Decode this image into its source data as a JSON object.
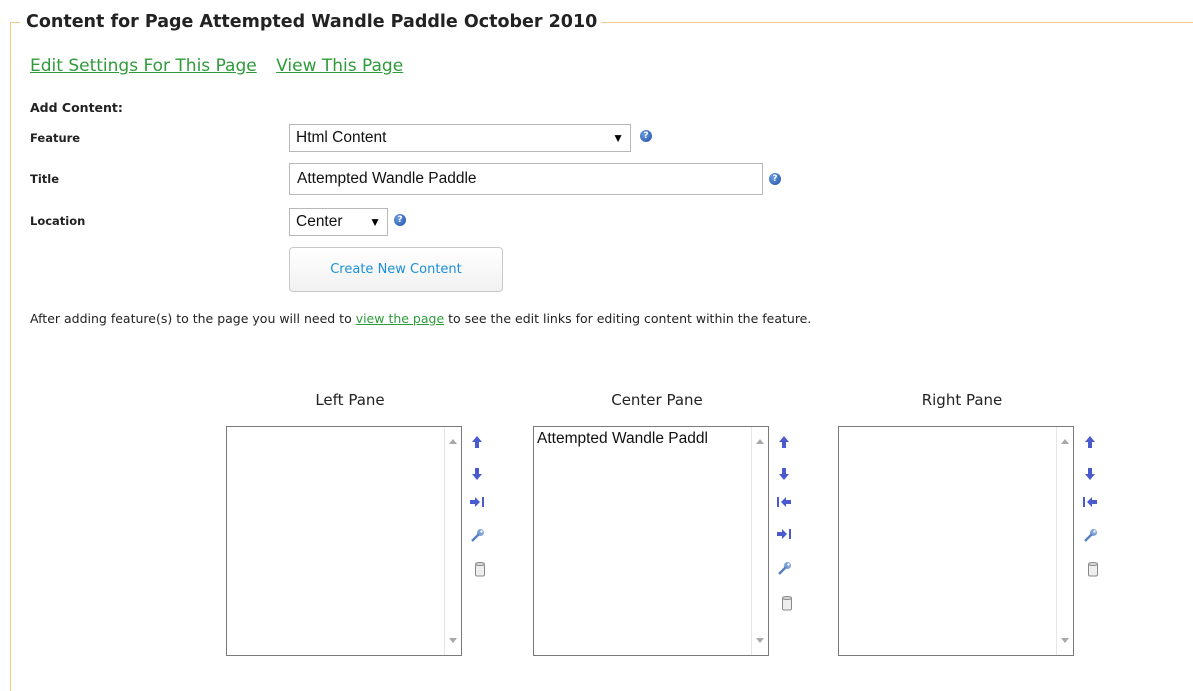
{
  "legend": "Content for Page Attempted Wandle Paddle October 2010",
  "links": {
    "edit_settings": "Edit Settings For This Page",
    "view_page": "View This Page"
  },
  "form": {
    "add_content_label": "Add Content:",
    "feature_label": "Feature",
    "feature_value": "Html Content",
    "title_label": "Title",
    "title_value": "Attempted Wandle Paddle",
    "location_label": "Location",
    "location_value": "Center",
    "help_glyph": "?",
    "create_button": "Create New Content"
  },
  "note": {
    "before": "After adding feature(s) to the page you will need to ",
    "link": "view the page",
    "after": " to see the edit links for editing content within the feature."
  },
  "panes": {
    "left": {
      "title": "Left Pane",
      "items": []
    },
    "center": {
      "title": "Center Pane",
      "items": [
        "Attempted Wandle Paddl"
      ]
    },
    "right": {
      "title": "Right Pane",
      "items": []
    }
  },
  "colors": {
    "link_green": "#2e9b3a",
    "button_text": "#1b8fd6",
    "fieldset_border": "#f5c98c",
    "tool_arrow": "#4a5bd0"
  }
}
